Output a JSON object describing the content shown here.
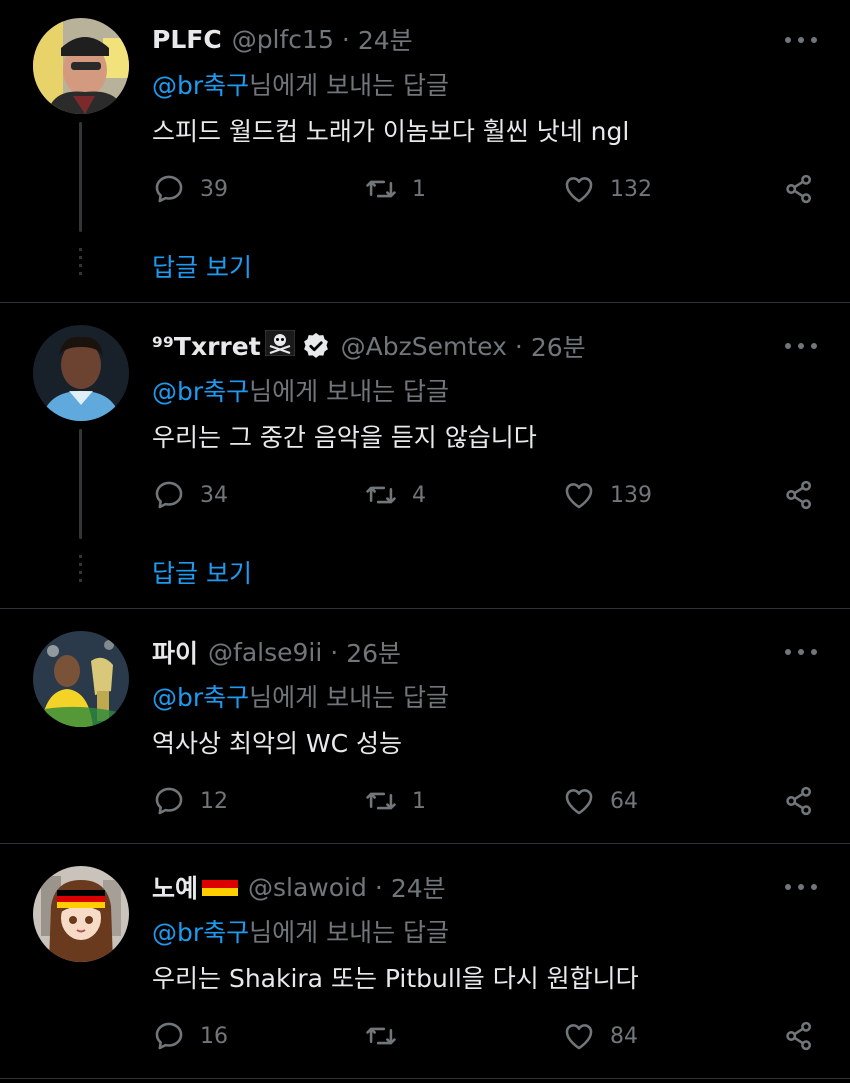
{
  "tweets": [
    {
      "display_name": "PLFC",
      "handle": "@plfc15",
      "time": "24분",
      "mention": "@br축구",
      "replying_suffix": "님에게 보내는 답글",
      "text": "스피드 월드컵 노래가 이놈보다 훨씬 낫네 ngl",
      "replies": "39",
      "retweets": "1",
      "likes": "132",
      "show_replies": "답글 보기"
    },
    {
      "display_name": "⁹⁹Txrret",
      "name_emoji": "skull-crossbones",
      "verified": true,
      "handle": "@AbzSemtex",
      "time": "26분",
      "mention": "@br축구",
      "replying_suffix": "님에게 보내는 답글",
      "text": "우리는 그 중간 음악을 듣지 않습니다",
      "replies": "34",
      "retweets": "4",
      "likes": "139",
      "show_replies": "답글 보기"
    },
    {
      "display_name": "파이",
      "handle": "@false9ii",
      "time": "26분",
      "mention": "@br축구",
      "replying_suffix": "님에게 보내는 답글",
      "text": "역사상 최악의 WC 성능",
      "replies": "12",
      "retweets": "1",
      "likes": "64"
    },
    {
      "display_name": "노예",
      "name_emoji": "germany-flag",
      "handle": "@slawoid",
      "time": "24분",
      "mention": "@br축구",
      "replying_suffix": "님에게 보내는 답글",
      "text": "우리는 Shakira 또는 Pitbull을 다시 원합니다",
      "replies": "16",
      "retweets": "",
      "likes": "84"
    }
  ],
  "colors": {
    "background": "#000000",
    "text_primary": "#e7e9ea",
    "text_secondary": "#71767b",
    "accent": "#1d9bf0",
    "divider": "#2f3336"
  }
}
